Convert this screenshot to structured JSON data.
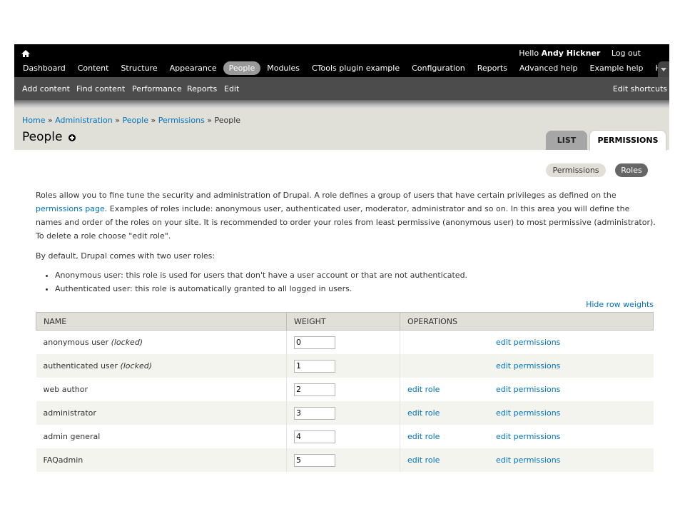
{
  "toolbar": {
    "greeting_prefix": "Hello",
    "user_name": "Andy Hickner",
    "logout": "Log out",
    "menu": [
      {
        "label": "Dashboard",
        "active": false
      },
      {
        "label": "Content",
        "active": false
      },
      {
        "label": "Structure",
        "active": false
      },
      {
        "label": "Appearance",
        "active": false
      },
      {
        "label": "People",
        "active": true
      },
      {
        "label": "Modules",
        "active": false
      },
      {
        "label": "CTools plugin example",
        "active": false
      },
      {
        "label": "Configuration",
        "active": false
      },
      {
        "label": "Reports",
        "active": false
      },
      {
        "label": "Advanced help",
        "active": false
      },
      {
        "label": "Example help",
        "active": false
      },
      {
        "label": "Help",
        "active": false
      }
    ]
  },
  "shortcuts": {
    "items": [
      "Add content",
      "Find content",
      "Performance",
      "Reports",
      "Edit"
    ],
    "edit_shortcuts": "Edit shortcuts"
  },
  "breadcrumb": [
    "Home",
    "Administration",
    "People",
    "Permissions",
    "People"
  ],
  "page": {
    "title": "People"
  },
  "primary_tabs": {
    "list": "LIST",
    "permissions": "PERMISSIONS"
  },
  "secondary_tabs": {
    "permissions": "Permissions",
    "roles": "Roles"
  },
  "help": {
    "p1_before_link": "Roles allow you to fine tune the security and administration of Drupal. A role defines a group of users that have certain privileges as defined on the ",
    "p1_link": "permissions page",
    "p1_after_link": ". Examples of roles include: anonymous user, authenticated user, moderator, administrator and so on. In this area you will define the names and order of the roles on your site. It is recommended to order your roles from least permissive (anonymous user) to most permissive (administrator). To delete a role choose \"edit role\".",
    "p2": "By default, Drupal comes with two user roles:",
    "bullets": [
      "Anonymous user: this role is used for users that don't have a user account or that are not authenticated.",
      "Authenticated user: this role is automatically granted to all logged in users."
    ]
  },
  "hide_row_weights": "Hide row weights",
  "table": {
    "headers": [
      "NAME",
      "WEIGHT",
      "OPERATIONS"
    ],
    "rows": [
      {
        "name": "anonymous user",
        "note": "(locked)",
        "weight": "0",
        "edit_role": "",
        "edit_permissions": "edit permissions"
      },
      {
        "name": "authenticated user",
        "note": "(locked)",
        "weight": "1",
        "edit_role": "",
        "edit_permissions": "edit permissions"
      },
      {
        "name": "web author",
        "note": "",
        "weight": "2",
        "edit_role": "edit role",
        "edit_permissions": "edit permissions"
      },
      {
        "name": "administrator",
        "note": "",
        "weight": "3",
        "edit_role": "edit role",
        "edit_permissions": "edit permissions"
      },
      {
        "name": "admin general",
        "note": "",
        "weight": "4",
        "edit_role": "edit role",
        "edit_permissions": "edit permissions"
      },
      {
        "name": "FAQadmin",
        "note": "",
        "weight": "5",
        "edit_role": "edit role",
        "edit_permissions": "edit permissions"
      }
    ]
  }
}
